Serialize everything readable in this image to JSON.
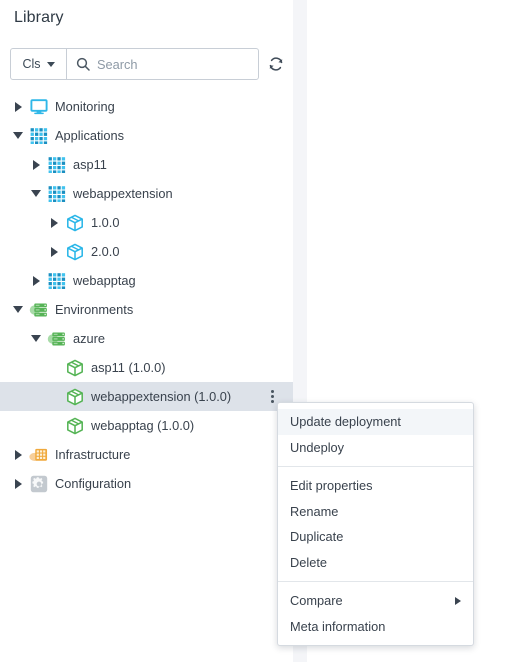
{
  "panel": {
    "title": "Library",
    "search": {
      "filter_label": "Cls",
      "filter_icon": "chevron-down-icon",
      "search_icon": "search-icon",
      "placeholder": "Search",
      "value": "",
      "refresh_icon": "refresh-icon"
    }
  },
  "tree": {
    "nodes": [
      {
        "label": "Monitoring",
        "icon": "monitor-icon",
        "indent": 0,
        "twisty": "collapsed",
        "selected": false,
        "kebab": false
      },
      {
        "label": "Applications",
        "icon": "grid-blue-icon",
        "indent": 0,
        "twisty": "expanded",
        "selected": false,
        "kebab": false
      },
      {
        "label": "asp11",
        "icon": "grid-blue-icon",
        "indent": 1,
        "twisty": "collapsed",
        "selected": false,
        "kebab": false
      },
      {
        "label": "webappextension",
        "icon": "grid-blue-icon",
        "indent": 1,
        "twisty": "expanded",
        "selected": false,
        "kebab": false
      },
      {
        "label": "1.0.0",
        "icon": "package-blue-icon",
        "indent": 2,
        "twisty": "collapsed",
        "selected": false,
        "kebab": false
      },
      {
        "label": "2.0.0",
        "icon": "package-blue-icon",
        "indent": 2,
        "twisty": "collapsed",
        "selected": false,
        "kebab": false
      },
      {
        "label": "webapptag",
        "icon": "grid-blue-icon",
        "indent": 1,
        "twisty": "collapsed",
        "selected": false,
        "kebab": false
      },
      {
        "label": "Environments",
        "icon": "server-green-icon",
        "indent": 0,
        "twisty": "expanded",
        "selected": false,
        "kebab": false
      },
      {
        "label": "azure",
        "icon": "server-green-icon",
        "indent": 1,
        "twisty": "expanded",
        "selected": false,
        "kebab": false
      },
      {
        "label": "asp11 (1.0.0)",
        "icon": "package-green-icon",
        "indent": 2,
        "twisty": "empty",
        "selected": false,
        "kebab": false
      },
      {
        "label": "webappextension (1.0.0)",
        "icon": "package-green-icon",
        "indent": 2,
        "twisty": "empty",
        "selected": true,
        "kebab": true
      },
      {
        "label": "webapptag (1.0.0)",
        "icon": "package-green-icon",
        "indent": 2,
        "twisty": "empty",
        "selected": false,
        "kebab": false
      },
      {
        "label": "Infrastructure",
        "icon": "infrastructure-icon",
        "indent": 0,
        "twisty": "collapsed",
        "selected": false,
        "kebab": false
      },
      {
        "label": "Configuration",
        "icon": "gear-icon",
        "indent": 0,
        "twisty": "collapsed",
        "selected": false,
        "kebab": false
      }
    ]
  },
  "context_menu": {
    "groups": [
      {
        "items": [
          {
            "label": "Update deployment",
            "hover": true,
            "submenu": false
          },
          {
            "label": "Undeploy",
            "hover": false,
            "submenu": false
          }
        ]
      },
      {
        "items": [
          {
            "label": "Edit properties",
            "hover": false,
            "submenu": false
          },
          {
            "label": "Rename",
            "hover": false,
            "submenu": false
          },
          {
            "label": "Duplicate",
            "hover": false,
            "submenu": false
          },
          {
            "label": "Delete",
            "hover": false,
            "submenu": false
          }
        ]
      },
      {
        "items": [
          {
            "label": "Compare",
            "hover": false,
            "submenu": true
          },
          {
            "label": "Meta information",
            "hover": false,
            "submenu": false
          }
        ]
      }
    ]
  },
  "colors": {
    "blue_dark": "#1a8fc1",
    "blue_light": "#3fc3ef",
    "green": "#5cb85c",
    "green_light": "#8bd48b",
    "orange": "#f0ac4e",
    "gray": "#9aa3ad",
    "selected_row": "#dde2e9",
    "text": "#39424d",
    "panel_gap": "#f4f5f8"
  }
}
